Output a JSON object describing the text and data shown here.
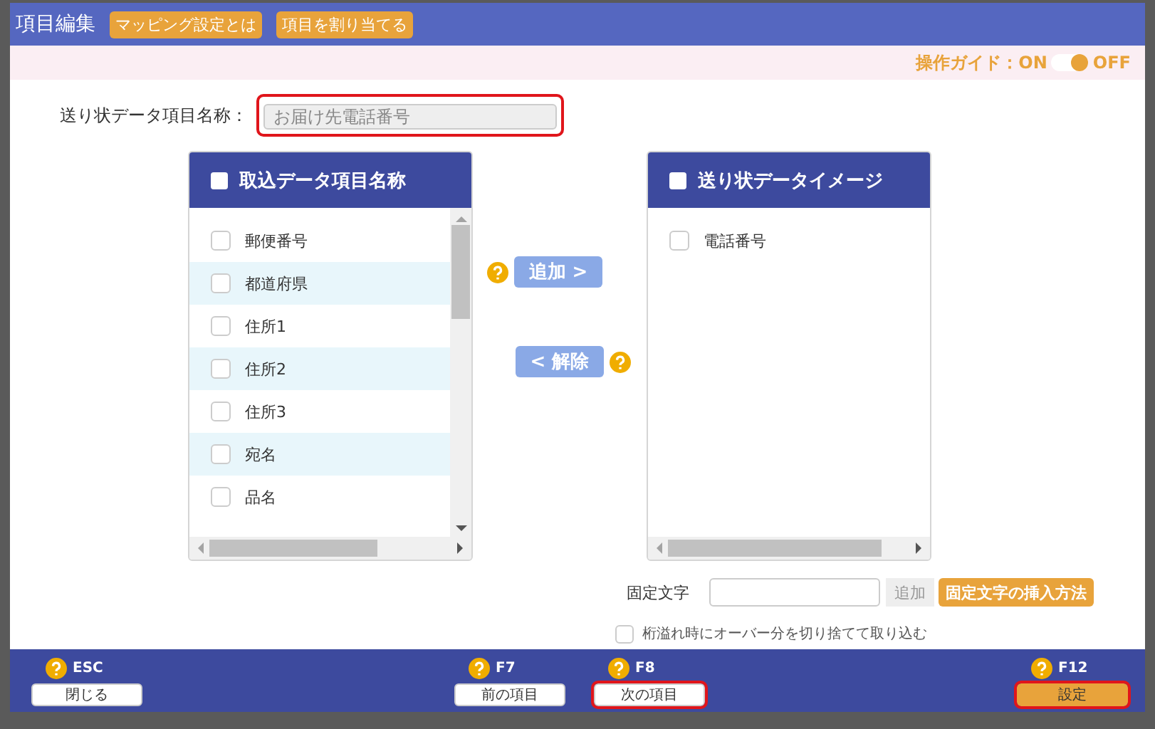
{
  "dialog": {
    "title": "項目編集",
    "header_buttons": [
      "マッピング設定とは",
      "項目を割り当てる"
    ]
  },
  "guide": {
    "label": "操作ガイド：ON",
    "off_label": "OFF",
    "on": true
  },
  "name_field": {
    "label": "送り状データ項目名称：",
    "placeholder": "お届け先電話番号",
    "highlighted": true
  },
  "source_list": {
    "title": "取込データ項目名称",
    "checked": false,
    "items": [
      {
        "label": "郵便番号",
        "checked": false
      },
      {
        "label": "都道府県",
        "checked": false
      },
      {
        "label": "住所1",
        "checked": false
      },
      {
        "label": "住所2",
        "checked": false
      },
      {
        "label": "住所3",
        "checked": false
      },
      {
        "label": "宛名",
        "checked": false
      },
      {
        "label": "品名",
        "checked": false
      }
    ]
  },
  "target_list": {
    "title": "送り状データイメージ",
    "checked": false,
    "items": [
      {
        "label": "電話番号",
        "checked": false
      }
    ]
  },
  "add_button": {
    "label": "追加 >",
    "disabled": true
  },
  "remove_button": {
    "label": "< 解除",
    "disabled": true
  },
  "fixed_text": {
    "label": "固定文字",
    "add_label": "追加",
    "help_button": "固定文字の挿入方法"
  },
  "truncate_option": {
    "label": "桁溢れ時にオーバー分を切り捨てて取り込む",
    "checked": false
  },
  "footer_buttons": [
    {
      "key": "ESC",
      "label": "閉じる",
      "kind": "plain",
      "highlighted": false
    },
    {
      "key": "F7",
      "label": "前の項目",
      "kind": "plain",
      "highlighted": false
    },
    {
      "key": "F8",
      "label": "次の項目",
      "kind": "plain",
      "highlighted": true
    },
    {
      "key": "F12",
      "label": "設定",
      "kind": "primary",
      "highlighted": true
    }
  ]
}
